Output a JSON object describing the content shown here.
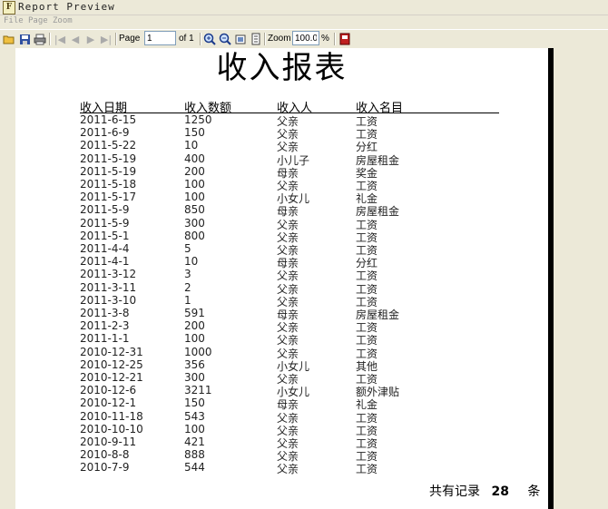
{
  "window": {
    "title": "Report Preview"
  },
  "menu": [
    "File",
    "Page",
    "Zoom"
  ],
  "toolbar": {
    "page_label": "Page",
    "page_value": "1",
    "of_label": "of 1",
    "zoom_label": "Zoom",
    "zoom_value": "100.0",
    "percent_label": "%"
  },
  "report": {
    "title": "收入报表",
    "columns": [
      "收入日期",
      "收入数额",
      "收入人",
      "收入名目"
    ],
    "rows": [
      [
        "2011-6-15",
        "1250",
        "父亲",
        "工资"
      ],
      [
        "2011-6-9",
        "150",
        "父亲",
        "工资"
      ],
      [
        "2011-5-22",
        "10",
        "父亲",
        "分红"
      ],
      [
        "2011-5-19",
        "400",
        "小儿子",
        "房屋租金"
      ],
      [
        "2011-5-19",
        "200",
        "母亲",
        "奖金"
      ],
      [
        "2011-5-18",
        "100",
        "父亲",
        "工资"
      ],
      [
        "2011-5-17",
        "100",
        "小女儿",
        "礼金"
      ],
      [
        "2011-5-9",
        "850",
        "母亲",
        "房屋租金"
      ],
      [
        "2011-5-9",
        "300",
        "父亲",
        "工资"
      ],
      [
        "2011-5-1",
        "800",
        "父亲",
        "工资"
      ],
      [
        "2011-4-4",
        "5",
        "父亲",
        "工资"
      ],
      [
        "2011-4-1",
        "10",
        "母亲",
        "分红"
      ],
      [
        "2011-3-12",
        "3",
        "父亲",
        "工资"
      ],
      [
        "2011-3-11",
        "2",
        "父亲",
        "工资"
      ],
      [
        "2011-3-10",
        "1",
        "父亲",
        "工资"
      ],
      [
        "2011-3-8",
        "591",
        "母亲",
        "房屋租金"
      ],
      [
        "2011-2-3",
        "200",
        "父亲",
        "工资"
      ],
      [
        "2011-1-1",
        "100",
        "父亲",
        "工资"
      ],
      [
        "2010-12-31",
        "1000",
        "父亲",
        "工资"
      ],
      [
        "2010-12-25",
        "356",
        "小女儿",
        "其他"
      ],
      [
        "2010-12-21",
        "300",
        "父亲",
        "工资"
      ],
      [
        "2010-12-6",
        "3211",
        "小女儿",
        "额外津贴"
      ],
      [
        "2010-12-1",
        "150",
        "母亲",
        "礼金"
      ],
      [
        "2010-11-18",
        "543",
        "父亲",
        "工资"
      ],
      [
        "2010-10-10",
        "100",
        "父亲",
        "工资"
      ],
      [
        "2010-9-11",
        "421",
        "父亲",
        "工资"
      ],
      [
        "2010-8-8",
        "888",
        "父亲",
        "工资"
      ],
      [
        "2010-7-9",
        "544",
        "父亲",
        "工资"
      ]
    ],
    "footer": {
      "prefix": "共有记录",
      "count": "28",
      "suffix": "条"
    }
  }
}
